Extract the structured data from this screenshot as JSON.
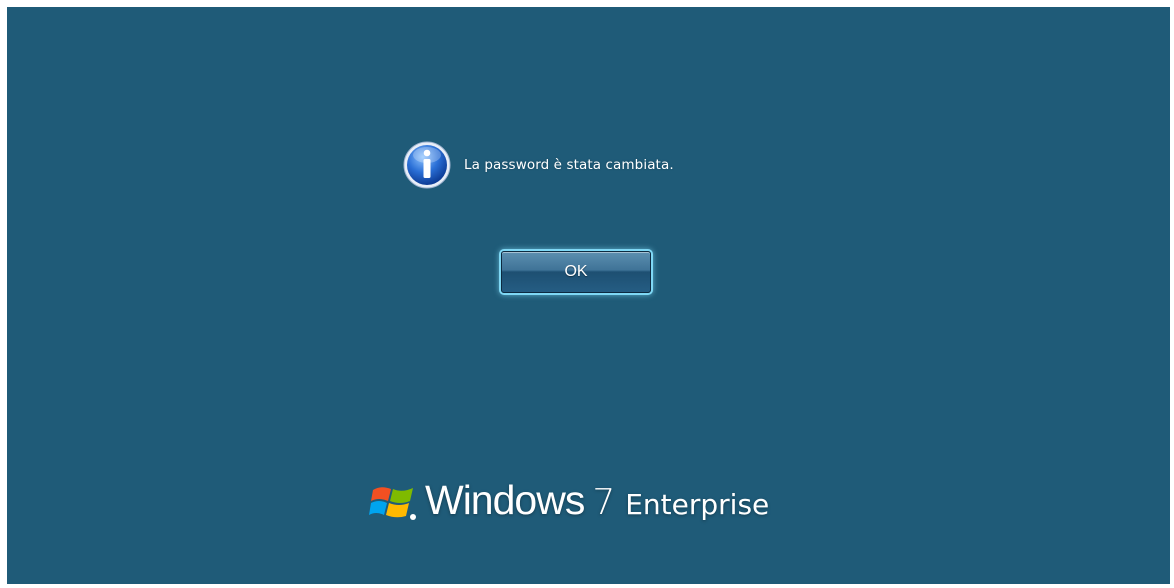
{
  "dialog": {
    "message": "La password è stata cambiata.",
    "ok_label": "OK",
    "icon": "info-icon"
  },
  "branding": {
    "product": "Windows",
    "version": "7",
    "edition": "Enterprise",
    "logo": "windows-flag-logo"
  },
  "colors": {
    "background": "#1f5b78",
    "button_glow": "#7fd8f5",
    "text": "#ffffff"
  }
}
